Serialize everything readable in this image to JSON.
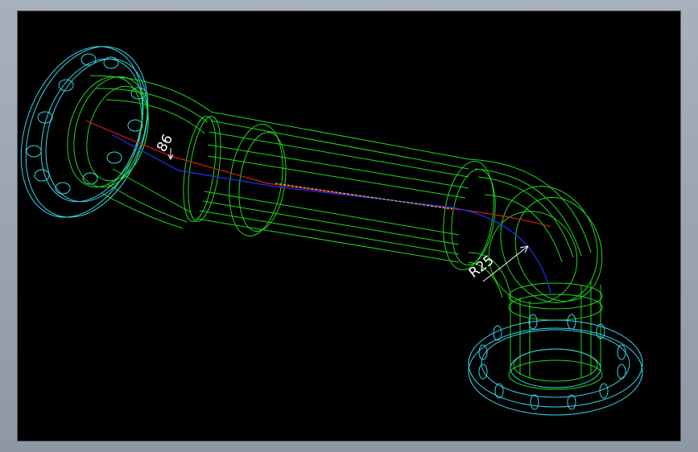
{
  "drawing": {
    "dimension_radius_label": "R25",
    "dimension_small_label": "86",
    "colors": {
      "background": "#000000",
      "flange": "#33d6e6",
      "pipe": "#1fd91f",
      "centerline_red": "#e01818",
      "centerline_blue": "#2030ff",
      "dimension": "#ffffff"
    }
  }
}
